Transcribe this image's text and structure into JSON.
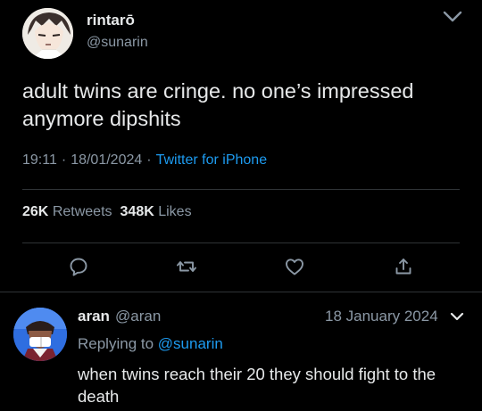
{
  "tweet": {
    "author_name": "rintarō",
    "author_handle": "@sunarin",
    "text": "adult twins are cringe. no one’s impressed anymore dipshits",
    "time": "19:11",
    "separator": "·",
    "date": "18/01/2024",
    "source": "Twitter for iPhone",
    "retweets_count": "26K",
    "retweets_label": "Retweets",
    "likes_count": "348K",
    "likes_label": "Likes",
    "avatar_icon": "anime-character-avatar",
    "actions": [
      "reply-icon",
      "retweet-icon",
      "like-icon",
      "share-icon"
    ]
  },
  "reply": {
    "author_name": "aran",
    "author_handle": "@aran",
    "date": "18 January 2024",
    "replying_prefix": "Replying to",
    "replying_to": "@sunarin",
    "text": "when twins reach their 20 they should fight to the death",
    "avatar_icon": "anime-character-avatar"
  },
  "colors": {
    "background": "#000000",
    "primary_text": "#e7e9ea",
    "secondary_text": "#8b98a5",
    "link": "#1d9bf0",
    "divider": "#2f3336"
  }
}
